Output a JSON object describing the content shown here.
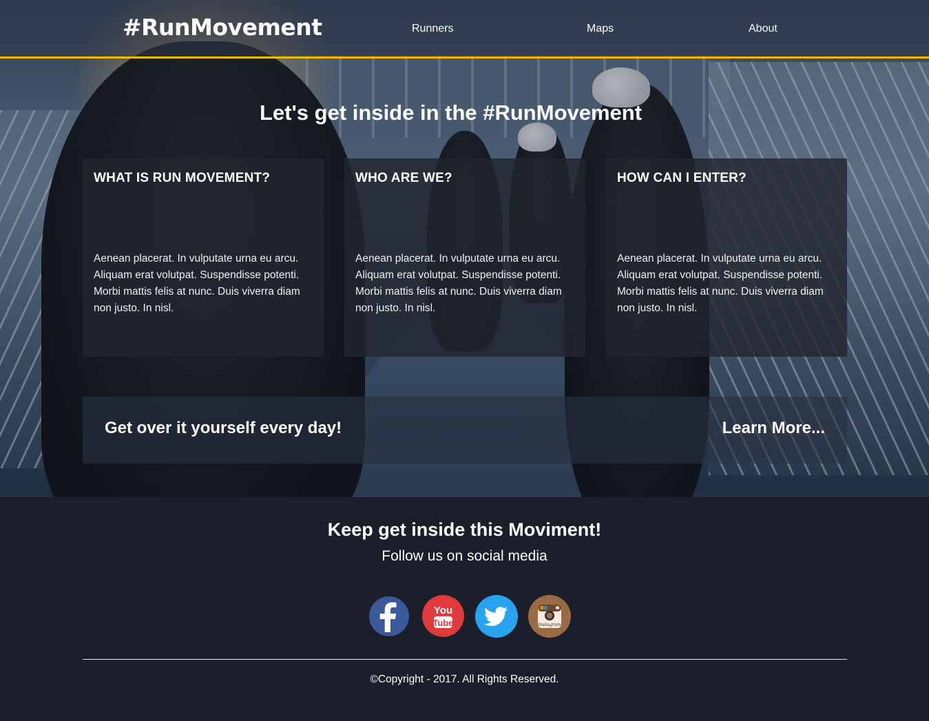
{
  "nav": {
    "logo": "#RunMovement",
    "links": [
      {
        "label": "Runners"
      },
      {
        "label": "Maps"
      },
      {
        "label": "About"
      }
    ]
  },
  "hero": {
    "title": "Let's get inside in the #RunMovement",
    "cards": [
      {
        "heading": "WHAT IS RUN MOVEMENT?",
        "body": "Aenean placerat. In vulputate urna eu arcu. Aliquam erat volutpat. Suspendisse potenti. Morbi mattis felis at nunc. Duis viverra diam non justo. In nisl."
      },
      {
        "heading": "WHO ARE WE?",
        "body": "Aenean placerat. In vulputate urna eu arcu. Aliquam erat volutpat. Suspendisse potenti. Morbi mattis felis at nunc. Duis viverra diam non justo. In nisl."
      },
      {
        "heading": "HOW CAN I ENTER?",
        "body": "Aenean placerat. In vulputate urna eu arcu. Aliquam erat volutpat. Suspendisse potenti. Morbi mattis felis at nunc. Duis viverra diam non justo. In nisl."
      }
    ],
    "cta": {
      "text": "Get over it yourself every day!",
      "link": "Learn More..."
    }
  },
  "footer": {
    "title": "Keep get inside this Moviment!",
    "subtitle": "Follow us on social media",
    "social": [
      {
        "icon": "facebook-icon",
        "color": "#3b5998"
      },
      {
        "icon": "youtube-icon",
        "color": "#e0393e",
        "text_top": "You",
        "text_bottom": "Tube"
      },
      {
        "icon": "twitter-icon",
        "color": "#2aa3ef"
      },
      {
        "icon": "instagram-icon",
        "color": "#9a6c45",
        "text": "Instagram"
      }
    ],
    "copyright": "©Copyright - 2017. All Rights Reserved."
  },
  "colors": {
    "accent": "#f5b800",
    "footer_bg": "#1a1f2b"
  }
}
